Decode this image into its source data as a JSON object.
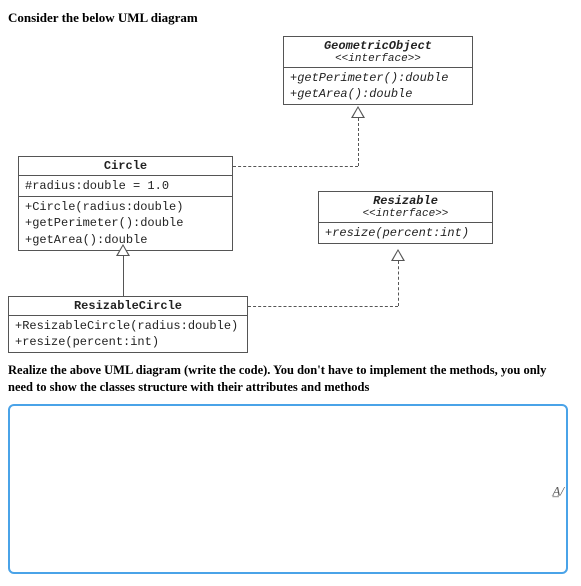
{
  "heading": "Consider the below UML diagram",
  "uml": {
    "geometricObject": {
      "name": "GeometricObject",
      "stereotype": "<<interface>>",
      "methods": [
        "+getPerimeter():double",
        "+getArea():double"
      ]
    },
    "circle": {
      "name": "Circle",
      "attributes": [
        "#radius:double = 1.0"
      ],
      "methods": [
        "+Circle(radius:double)",
        "+getPerimeter():double",
        "+getArea():double"
      ]
    },
    "resizable": {
      "name": "Resizable",
      "stereotype": "<<interface>>",
      "methods": [
        "+resize(percent:int)"
      ]
    },
    "resizableCircle": {
      "name": "ResizableCircle",
      "methods": [
        "+ResizableCircle(radius:double)",
        "+resize(percent:int)"
      ]
    }
  },
  "instruction": "Realize the above UML diagram (write the code). You don't have to implement the methods, you only need to show the classes structure with their attributes and methods",
  "answer": {
    "value": "",
    "placeholder": ""
  },
  "fontToggleGlyph": "A̲/"
}
